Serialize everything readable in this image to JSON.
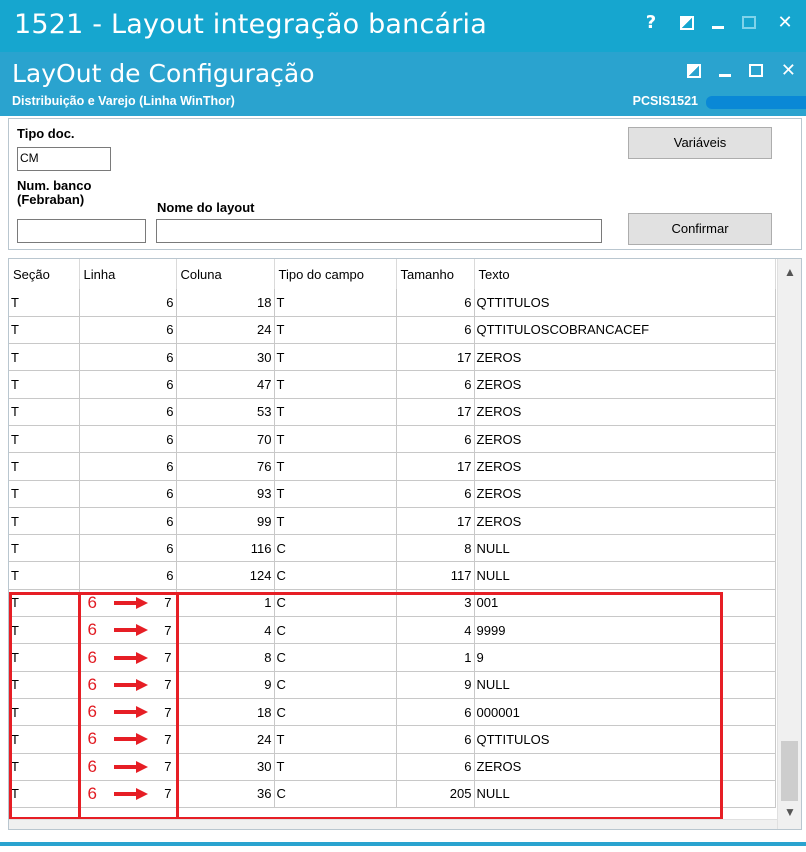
{
  "window": {
    "title": "1521 - Layout integração bancária",
    "help_label": "?"
  },
  "inner": {
    "title": "LayOut de Configuração",
    "subtitle": "Distribuição e Varejo (Linha WinThor)",
    "routine_code": "PCSIS1521"
  },
  "form": {
    "tipo_doc_label": "Tipo doc.",
    "tipo_doc_value": "CM",
    "num_banco_label_line1": "Num. banco",
    "num_banco_label_line2": "(Febraban)",
    "num_banco_value": "",
    "nome_layout_label": "Nome do layout",
    "nome_layout_value": "",
    "variaveis_button": "Variáveis",
    "confirmar_button": "Confirmar"
  },
  "grid": {
    "columns": [
      "Seção",
      "Linha",
      "Coluna",
      "Tipo do campo",
      "Tamanho",
      "Texto"
    ],
    "rows": [
      {
        "secao": "T",
        "linha": "6",
        "coluna": "18",
        "tipo": "T",
        "tamanho": "6",
        "texto": "QTTITULOS"
      },
      {
        "secao": "T",
        "linha": "6",
        "coluna": "24",
        "tipo": "T",
        "tamanho": "6",
        "texto": "QTTITULOSCOBRANCACEF"
      },
      {
        "secao": "T",
        "linha": "6",
        "coluna": "30",
        "tipo": "T",
        "tamanho": "17",
        "texto": "ZEROS"
      },
      {
        "secao": "T",
        "linha": "6",
        "coluna": "47",
        "tipo": "T",
        "tamanho": "6",
        "texto": "ZEROS"
      },
      {
        "secao": "T",
        "linha": "6",
        "coluna": "53",
        "tipo": "T",
        "tamanho": "17",
        "texto": "ZEROS"
      },
      {
        "secao": "T",
        "linha": "6",
        "coluna": "70",
        "tipo": "T",
        "tamanho": "6",
        "texto": "ZEROS"
      },
      {
        "secao": "T",
        "linha": "6",
        "coluna": "76",
        "tipo": "T",
        "tamanho": "17",
        "texto": "ZEROS"
      },
      {
        "secao": "T",
        "linha": "6",
        "coluna": "93",
        "tipo": "T",
        "tamanho": "6",
        "texto": "ZEROS"
      },
      {
        "secao": "T",
        "linha": "6",
        "coluna": "99",
        "tipo": "T",
        "tamanho": "17",
        "texto": "ZEROS"
      },
      {
        "secao": "T",
        "linha": "6",
        "coluna": "116",
        "tipo": "C",
        "tamanho": "8",
        "texto": "NULL"
      },
      {
        "secao": "T",
        "linha": "6",
        "coluna": "124",
        "tipo": "C",
        "tamanho": "117",
        "texto": "NULL"
      },
      {
        "secao": "T",
        "linha": "7",
        "old_linha": "6",
        "coluna": "1",
        "tipo": "C",
        "tamanho": "3",
        "texto": "001"
      },
      {
        "secao": "T",
        "linha": "7",
        "old_linha": "6",
        "coluna": "4",
        "tipo": "C",
        "tamanho": "4",
        "texto": "9999"
      },
      {
        "secao": "T",
        "linha": "7",
        "old_linha": "6",
        "coluna": "8",
        "tipo": "C",
        "tamanho": "1",
        "texto": "9"
      },
      {
        "secao": "T",
        "linha": "7",
        "old_linha": "6",
        "coluna": "9",
        "tipo": "C",
        "tamanho": "9",
        "texto": "NULL"
      },
      {
        "secao": "T",
        "linha": "7",
        "old_linha": "6",
        "coluna": "18",
        "tipo": "C",
        "tamanho": "6",
        "texto": "000001"
      },
      {
        "secao": "T",
        "linha": "7",
        "old_linha": "6",
        "coluna": "24",
        "tipo": "T",
        "tamanho": "6",
        "texto": "QTTITULOS"
      },
      {
        "secao": "T",
        "linha": "7",
        "old_linha": "6",
        "coluna": "30",
        "tipo": "T",
        "tamanho": "6",
        "texto": "ZEROS"
      },
      {
        "secao": "T",
        "linha": "7",
        "old_linha": "6",
        "coluna": "36",
        "tipo": "C",
        "tamanho": "205",
        "texto": "NULL"
      }
    ]
  },
  "colors": {
    "title_bar": "#16a6cf",
    "inner_title_bar": "#2aa3cf",
    "annotation_red": "#e61e25"
  },
  "icons": {
    "help": "help-icon",
    "restore": "restore-icon",
    "minimize": "minimize-icon",
    "maximize": "maximize-icon",
    "close": "close-icon",
    "arrow": "right-arrow-icon"
  }
}
